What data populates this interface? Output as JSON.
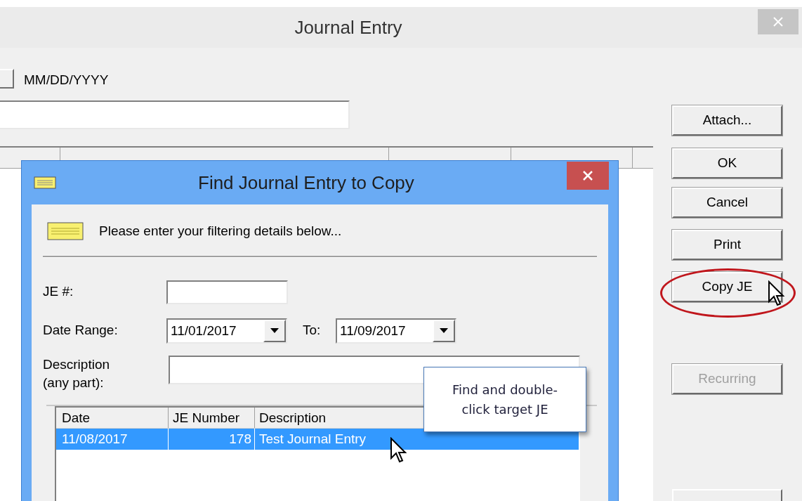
{
  "main_window": {
    "title": "Journal Entry",
    "date_format": "MM/DD/YYYY",
    "buttons": [
      {
        "label": "Attach...",
        "disabled": false,
        "circled": false
      },
      {
        "label": "OK",
        "disabled": false,
        "circled": false
      },
      {
        "label": "Cancel",
        "disabled": false,
        "circled": false
      },
      {
        "label": "Print",
        "disabled": false,
        "circled": false
      },
      {
        "label": "Copy JE",
        "disabled": false,
        "circled": true
      },
      {
        "label": "Recurring",
        "disabled": true,
        "circled": false
      }
    ]
  },
  "dialog": {
    "title": "Find Journal Entry to Copy",
    "instructions": "Please enter your filtering details below...",
    "je_number_label": "JE #:",
    "date_range_label": "Date Range:",
    "date_from": "11/01/2017",
    "to_label": "To:",
    "date_to": "11/09/2017",
    "description_label": "Description\n(any part):",
    "list": {
      "columns": [
        "Date",
        "JE Number",
        "Description"
      ],
      "rows": [
        {
          "date": "11/08/2017",
          "je_number": "178",
          "description": "Test Journal Entry",
          "selected": true
        }
      ]
    }
  },
  "tooltip": "Find and double-\nclick target JE"
}
